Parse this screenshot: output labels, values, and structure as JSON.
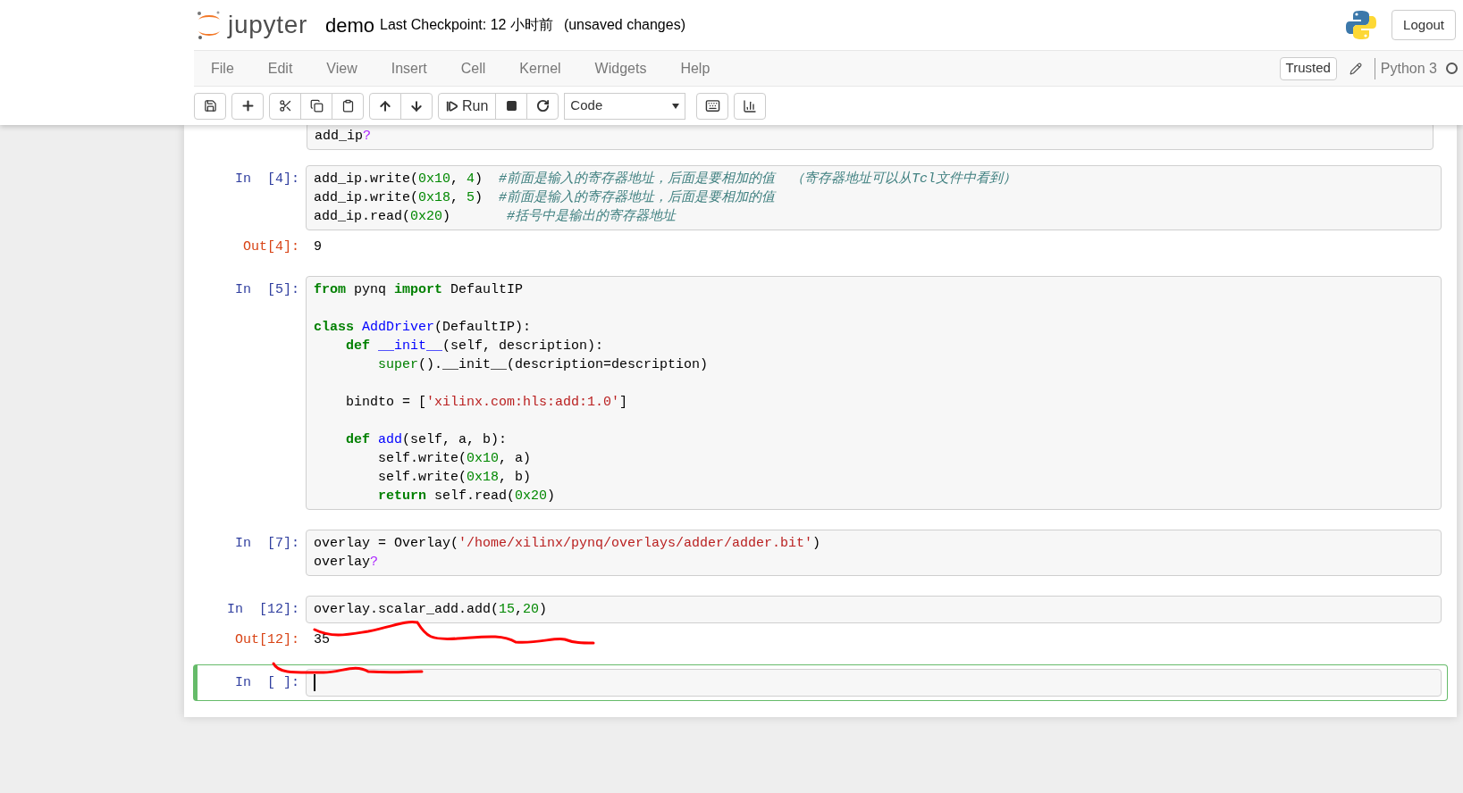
{
  "header": {
    "logo_text": "jupyter",
    "notebook_name": "demo",
    "checkpoint": "Last Checkpoint: 12 小时前",
    "save_status": "(unsaved changes)",
    "logout": "Logout"
  },
  "menu": [
    "File",
    "Edit",
    "View",
    "Insert",
    "Cell",
    "Kernel",
    "Widgets",
    "Help"
  ],
  "trusted": "Trusted",
  "kernel": "Python 3",
  "toolbar": {
    "run": "Run",
    "cell_type": "Code"
  },
  "cells": [
    {
      "partial": true,
      "selected": false,
      "lines": [
        {
          "kind": "code",
          "tokens": [
            {
              "kind": "name",
              "text": "add_ip"
            },
            {
              "kind": "op",
              "text": "?"
            }
          ]
        }
      ]
    },
    {
      "partial": false,
      "selected": false,
      "prompt": "In  [4]:",
      "lines": [
        {
          "kind": "code",
          "tokens": [
            {
              "kind": "name",
              "text": "add_ip.write("
            },
            {
              "kind": "num",
              "text": "0x10"
            },
            {
              "kind": "name",
              "text": ", "
            },
            {
              "kind": "num",
              "text": "4"
            },
            {
              "kind": "name",
              "text": ")"
            },
            {
              "kind": "comment",
              "text": "  #前面是输入的寄存器地址，后面是要相加的值  （寄存器地址可以从Tcl文件中看到）"
            }
          ]
        },
        {
          "kind": "code",
          "tokens": [
            {
              "kind": "name",
              "text": "add_ip.write("
            },
            {
              "kind": "num",
              "text": "0x18"
            },
            {
              "kind": "name",
              "text": ", "
            },
            {
              "kind": "num",
              "text": "5"
            },
            {
              "kind": "name",
              "text": ")"
            },
            {
              "kind": "comment",
              "text": "  #前面是输入的寄存器地址，后面是要相加的值"
            }
          ]
        },
        {
          "kind": "code",
          "tokens": [
            {
              "kind": "name",
              "text": "add_ip.read("
            },
            {
              "kind": "num",
              "text": "0x20"
            },
            {
              "kind": "name",
              "text": ")"
            },
            {
              "kind": "comment",
              "text": "       #括号中是输出的寄存器地址"
            }
          ]
        }
      ],
      "out_prompt": "Out[4]:",
      "output": "9"
    },
    {
      "partial": false,
      "selected": false,
      "prompt": "In  [5]:",
      "lines": [
        {
          "kind": "code",
          "tokens": [
            {
              "kind": "kw",
              "text": "from"
            },
            {
              "kind": "name",
              "text": " pynq "
            },
            {
              "kind": "kw",
              "text": "import"
            },
            {
              "kind": "name",
              "text": " DefaultIP"
            }
          ]
        },
        {
          "kind": "blank"
        },
        {
          "kind": "code",
          "tokens": [
            {
              "kind": "kw",
              "text": "class"
            },
            {
              "kind": "def",
              "text": " AddDriver"
            },
            {
              "kind": "name",
              "text": "(DefaultIP):"
            }
          ]
        },
        {
          "kind": "code",
          "tokens": [
            {
              "kind": "kw",
              "text": "    def"
            },
            {
              "kind": "def",
              "text": " __init__"
            },
            {
              "kind": "name",
              "text": "(self, description):"
            }
          ]
        },
        {
          "kind": "code",
          "tokens": [
            {
              "kind": "builtin",
              "text": "        super"
            },
            {
              "kind": "name",
              "text": "().__init__(description=description)"
            }
          ]
        },
        {
          "kind": "blank"
        },
        {
          "kind": "code",
          "tokens": [
            {
              "kind": "name",
              "text": "    bindto = ["
            },
            {
              "kind": "str",
              "text": "'xilinx.com:hls:add:1.0'"
            },
            {
              "kind": "name",
              "text": "]"
            }
          ]
        },
        {
          "kind": "blank"
        },
        {
          "kind": "code",
          "tokens": [
            {
              "kind": "kw",
              "text": "    def"
            },
            {
              "kind": "def",
              "text": " add"
            },
            {
              "kind": "name",
              "text": "(self, a, b):"
            }
          ]
        },
        {
          "kind": "code",
          "tokens": [
            {
              "kind": "name",
              "text": "        self.write("
            },
            {
              "kind": "num",
              "text": "0x10"
            },
            {
              "kind": "name",
              "text": ", a)"
            }
          ]
        },
        {
          "kind": "code",
          "tokens": [
            {
              "kind": "name",
              "text": "        self.write("
            },
            {
              "kind": "num",
              "text": "0x18"
            },
            {
              "kind": "name",
              "text": ", b)"
            }
          ]
        },
        {
          "kind": "code",
          "tokens": [
            {
              "kind": "kw",
              "text": "        return"
            },
            {
              "kind": "name",
              "text": " self.read("
            },
            {
              "kind": "num",
              "text": "0x20"
            },
            {
              "kind": "name",
              "text": ")"
            }
          ]
        }
      ]
    },
    {
      "partial": false,
      "selected": false,
      "prompt": "In  [7]:",
      "lines": [
        {
          "kind": "code",
          "tokens": [
            {
              "kind": "name",
              "text": "overlay = Overlay("
            },
            {
              "kind": "str",
              "text": "'/home/xilinx/pynq/overlays/adder/adder.bit'"
            },
            {
              "kind": "name",
              "text": ")"
            }
          ]
        },
        {
          "kind": "code",
          "tokens": [
            {
              "kind": "name",
              "text": "overlay"
            },
            {
              "kind": "op",
              "text": "?"
            }
          ]
        }
      ]
    },
    {
      "partial": false,
      "selected": false,
      "prompt": "In  [12]:",
      "lines": [
        {
          "kind": "code",
          "tokens": [
            {
              "kind": "name",
              "text": "overlay.scalar_add.add("
            },
            {
              "kind": "num",
              "text": "15"
            },
            {
              "kind": "name",
              "text": ","
            },
            {
              "kind": "num",
              "text": "20"
            },
            {
              "kind": "name",
              "text": ")"
            }
          ]
        }
      ],
      "out_prompt": "Out[12]:",
      "output": "35"
    },
    {
      "partial": false,
      "selected": true,
      "prompt": "In  [ ]:",
      "lines": [
        {
          "kind": "blank"
        }
      ]
    }
  ]
}
